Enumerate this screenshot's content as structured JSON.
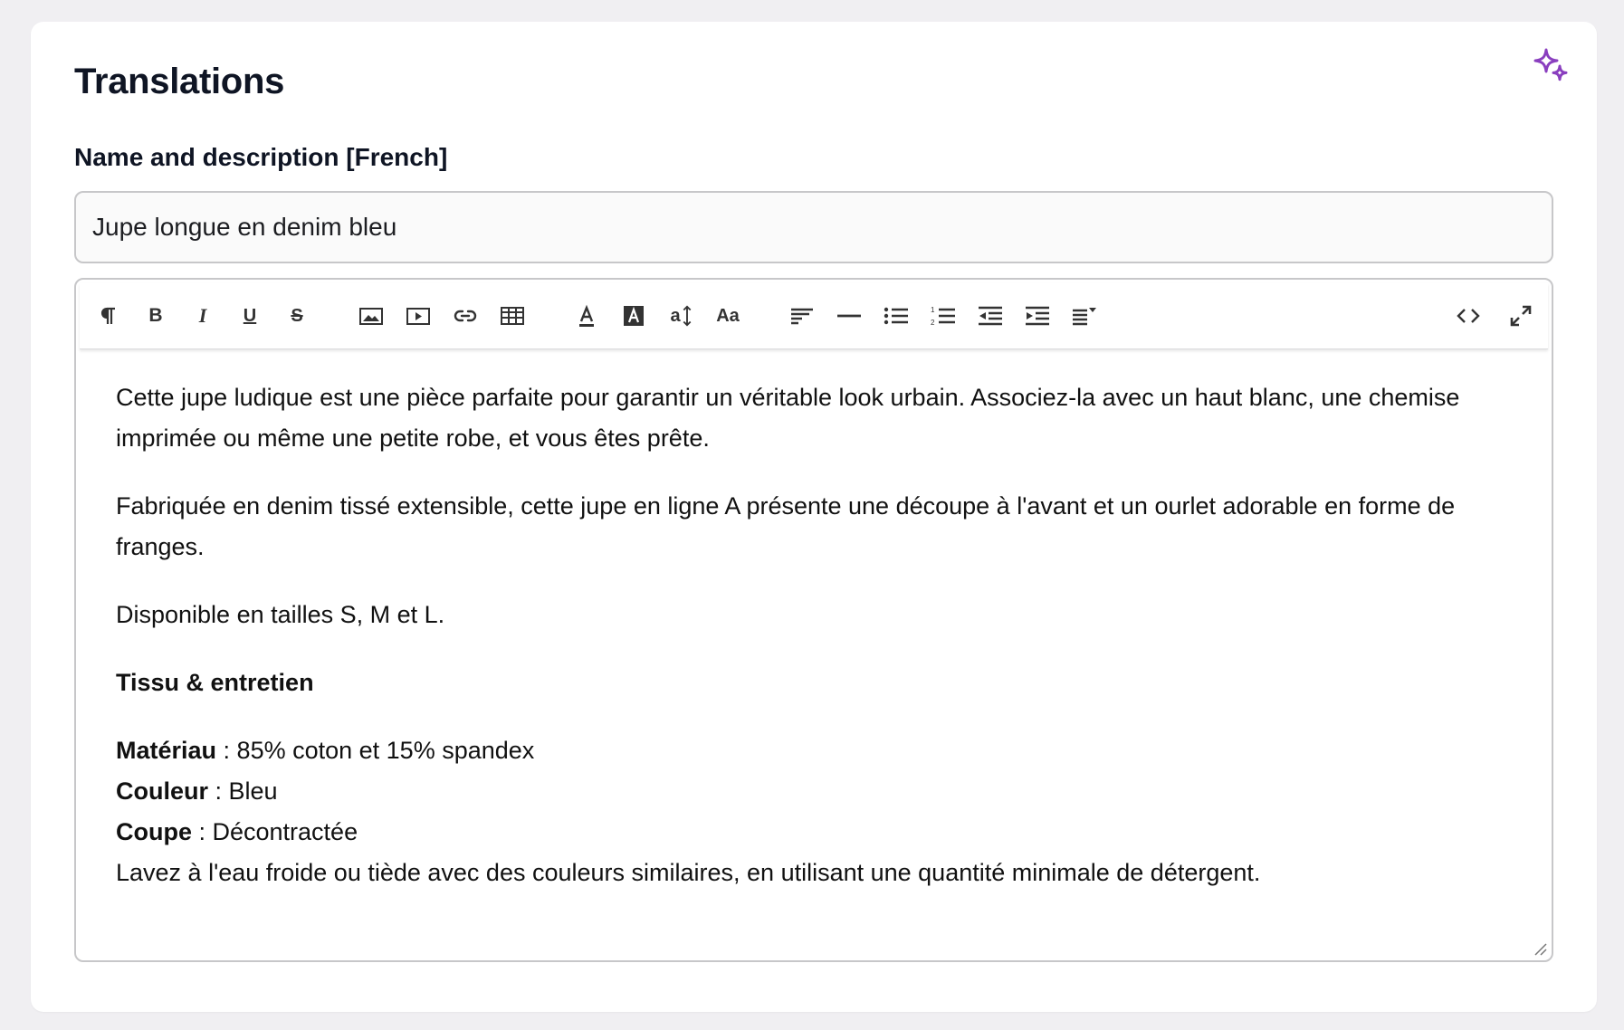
{
  "section": {
    "title": "Translations",
    "ai_icon": "sparkle-icon",
    "accent_color": "#8a3fbf"
  },
  "field": {
    "label": "Name and description [French]",
    "name_value": "Jupe longue en denim bleu"
  },
  "toolbar": {
    "icons": [
      "paragraph-icon",
      "bold-icon",
      "italic-icon",
      "underline-icon",
      "strikethrough-icon",
      "image-icon",
      "video-icon",
      "link-icon",
      "table-icon",
      "font-color-icon",
      "highlight-color-icon",
      "font-size-icon",
      "font-family-icon",
      "align-left-icon",
      "horizontal-rule-icon",
      "bullet-list-icon",
      "numbered-list-icon",
      "outdent-icon",
      "indent-icon",
      "line-height-icon",
      "code-view-icon",
      "fullscreen-icon"
    ],
    "labels": {
      "bold": "B",
      "italic": "I",
      "underline": "U",
      "strike": "S",
      "font_family": "Aa",
      "font_size": "a"
    }
  },
  "description": {
    "p1": "Cette jupe ludique est une pièce parfaite pour garantir un véritable look urbain. Associez-la avec un haut blanc, une chemise imprimée ou même une petite robe, et vous êtes prête.",
    "p2": "Fabriquée en denim tissé extensible, cette jupe en ligne A présente une découpe à l'avant et un ourlet adorable en forme de franges.",
    "p3": "Disponible en tailles S, M et L.",
    "heading": "Tissu & entretien",
    "material_label": "Matériau",
    "material_value": " : 85% coton et 15% spandex",
    "color_label": "Couleur",
    "color_value": " : Bleu",
    "fit_label": "Coupe",
    "fit_value": " : Décontractée",
    "care": "Lavez à l'eau froide ou tiède avec des couleurs similaires, en utilisant une quantité minimale de détergent."
  }
}
